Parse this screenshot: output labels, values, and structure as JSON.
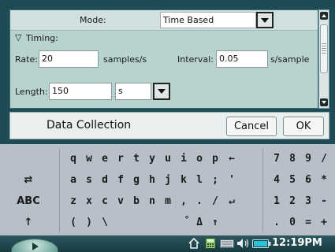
{
  "dialog": {
    "mode_label": "Mode:",
    "mode_value": "Time Based",
    "timing_label": "Timing:",
    "rate_label": "Rate:",
    "rate_value": "20",
    "rate_units": "samples/s",
    "interval_label": "Interval:",
    "interval_value": "0.05",
    "interval_units": "s/sample",
    "length_label": "Length:",
    "length_value": "150",
    "length_unit": "s"
  },
  "bottom_bar": {
    "title": "Data Collection",
    "cancel_label": "Cancel",
    "ok_label": "OK"
  },
  "keyboard": {
    "rows": [
      [
        "q",
        "w",
        "e",
        "r",
        "t",
        "y",
        "u",
        "i",
        "o",
        "p",
        "←"
      ],
      [
        "a",
        "s",
        "d",
        "f",
        "g",
        "h",
        "j",
        "k",
        "l",
        ";",
        "'"
      ],
      [
        "z",
        "x",
        "c",
        "v",
        "b",
        "n",
        "m",
        ",",
        ".",
        "/",
        "↵"
      ],
      [
        "(",
        ")",
        "\\",
        "",
        "",
        "",
        "",
        "°",
        "Δ",
        "↑",
        ""
      ]
    ],
    "numpad": [
      [
        "7",
        "8",
        "9",
        "/"
      ],
      [
        "4",
        "5",
        "6",
        "*"
      ],
      [
        "1",
        "2",
        "3",
        "-"
      ],
      [
        ".",
        "0",
        "=",
        "+"
      ]
    ],
    "left_keys": [
      "⇄",
      "ABC",
      "↑"
    ]
  },
  "taskbar": {
    "clock": "12:19PM"
  },
  "colors": {
    "dialog_bg": "#1d4b56",
    "panel_bg": "#b8d2d0",
    "keyboard_bg": "#b7c0c9",
    "taskbar_bg": "#1f474e"
  },
  "icons": [
    "home-icon",
    "calculator-icon",
    "keyboard-icon",
    "volume-icon",
    "battery-icon"
  ]
}
